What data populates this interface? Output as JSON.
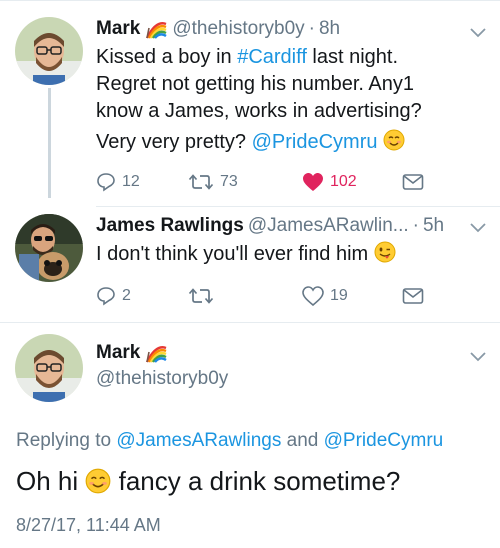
{
  "tweets": [
    {
      "name": "Mark",
      "handle": "@thehistoryb0y",
      "dot": "·",
      "time": "8h",
      "text_lines": [
        {
          "pre": "Kissed a boy in ",
          "link": "#Cardiff",
          "post": " last night."
        },
        {
          "pre": "Regret not getting his number. Any1",
          "link": "",
          "post": ""
        },
        {
          "pre": "know a James, works in advertising?",
          "link": "",
          "post": ""
        },
        {
          "pre": "Very very pretty? ",
          "link": "@PrideCymru",
          "post": ""
        }
      ],
      "replies": "12",
      "retweets": "73",
      "likes": "102"
    },
    {
      "name": "James Rawlings",
      "handle": "@JamesARawlin...",
      "dot": "·",
      "time": "5h",
      "text": "I don't think you'll ever find him",
      "replies": "2",
      "retweets": "",
      "likes": "19"
    }
  ],
  "focused": {
    "name": "Mark",
    "handle": "@thehistoryb0y",
    "reply_prefix": "Replying to ",
    "reply_user1": "@JamesARawlings",
    "reply_and": " and ",
    "reply_user2": "@PrideCymru",
    "text_pre": "Oh hi ",
    "text_post": " fancy a drink sometime?",
    "timestamp": "8/27/17, 11:44 AM"
  },
  "colors": {
    "link": "#1b95e0",
    "like": "#e0245e",
    "secondary": "#657786"
  },
  "icons": [
    "rainbow-flag-icon",
    "reply-icon",
    "retweet-icon",
    "heart-icon",
    "dm-icon",
    "chevron-down-icon",
    "emoji-icon"
  ]
}
